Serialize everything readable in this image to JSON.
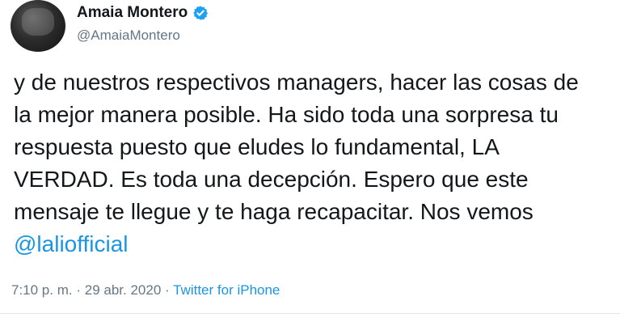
{
  "user": {
    "display_name": "Amaia Montero",
    "handle": "@AmaiaMontero",
    "verified_icon": "verified-badge-icon"
  },
  "tweet": {
    "lines": [
      "y de nuestros respectivos managers, hacer las cosas de",
      "la mejor manera posible. Ha sido toda una sorpresa tu",
      "respuesta puesto que eludes lo fundamental, LA",
      "VERDAD. Es toda una decepción. Espero que este",
      "mensaje te llegue y te haga recapacitar. Nos vemos"
    ],
    "mention": "@laliofficial"
  },
  "meta": {
    "time": "7:10 p. m.",
    "separator": "·",
    "date": "29 abr. 2020",
    "source": "Twitter for iPhone"
  },
  "colors": {
    "link": "#1b95e0",
    "secondary_text": "#657786",
    "primary_text": "#14171a",
    "verified": "#1da1f2"
  }
}
